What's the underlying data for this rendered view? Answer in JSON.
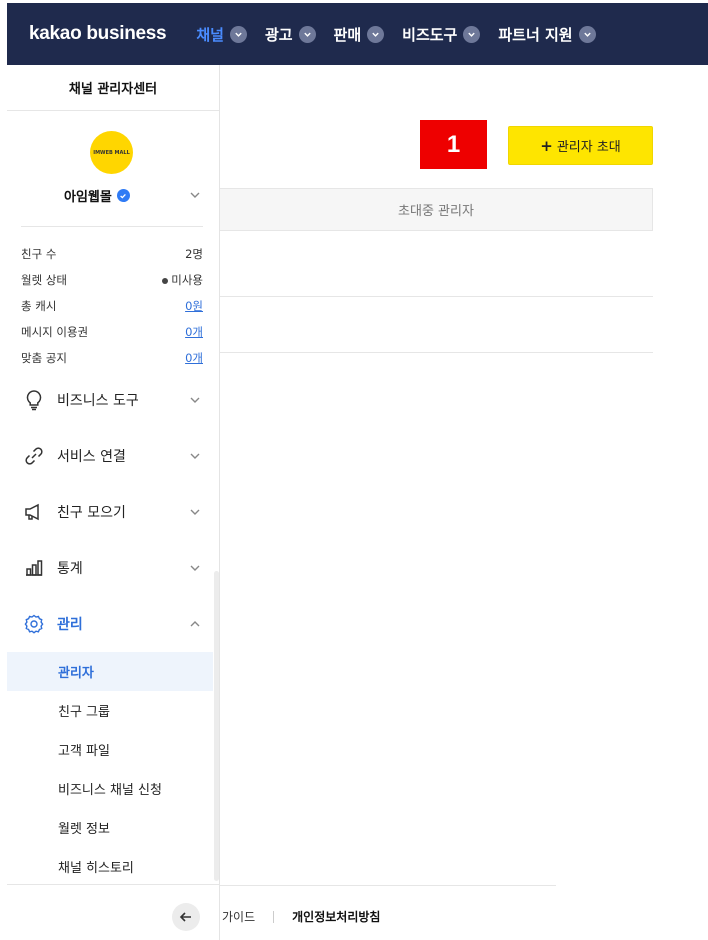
{
  "brand": "kakao business",
  "nav": [
    {
      "label": "채널",
      "active": true
    },
    {
      "label": "광고",
      "active": false
    },
    {
      "label": "판매",
      "active": false
    },
    {
      "label": "비즈도구",
      "active": false
    },
    {
      "label": "파트너 지원",
      "active": false
    }
  ],
  "sidebar": {
    "title": "채널 관리자센터",
    "logo_text": "IMWEB MALL",
    "channel_name": "아임웹몰",
    "stats": [
      {
        "label": "친구 수",
        "value": "2명"
      },
      {
        "label": "월렛 상태",
        "value": "미사용"
      },
      {
        "label": "총 캐시",
        "value": "0원"
      },
      {
        "label": "메시지 이용권",
        "value": "0개"
      },
      {
        "label": "맞춤 공지",
        "value": "0개"
      }
    ],
    "menu": [
      {
        "label": "비즈니스 도구",
        "icon": "lightbulb-icon"
      },
      {
        "label": "서비스 연결",
        "icon": "link-icon"
      },
      {
        "label": "친구 모으기",
        "icon": "megaphone-icon"
      },
      {
        "label": "통계",
        "icon": "bar-chart-icon"
      },
      {
        "label": "관리",
        "icon": "gear-icon"
      }
    ],
    "submenu": [
      "관리자",
      "친구 그룹",
      "고객 파일",
      "비즈니스 채널 신청",
      "월렛 정보",
      "채널 히스토리"
    ]
  },
  "main": {
    "badge": "1",
    "invite_button": "관리자 초대",
    "invite_plus": "+",
    "table_header": "초대중 관리자"
  },
  "footer": {
    "guide": "가이드",
    "privacy": "개인정보처리방침"
  },
  "colors": {
    "nav_bg": "#1f2a4d",
    "nav_active": "#4a8cff",
    "accent": "#2f6fd9",
    "invite_yellow": "#fee500",
    "badge_red": "#ee0000"
  }
}
